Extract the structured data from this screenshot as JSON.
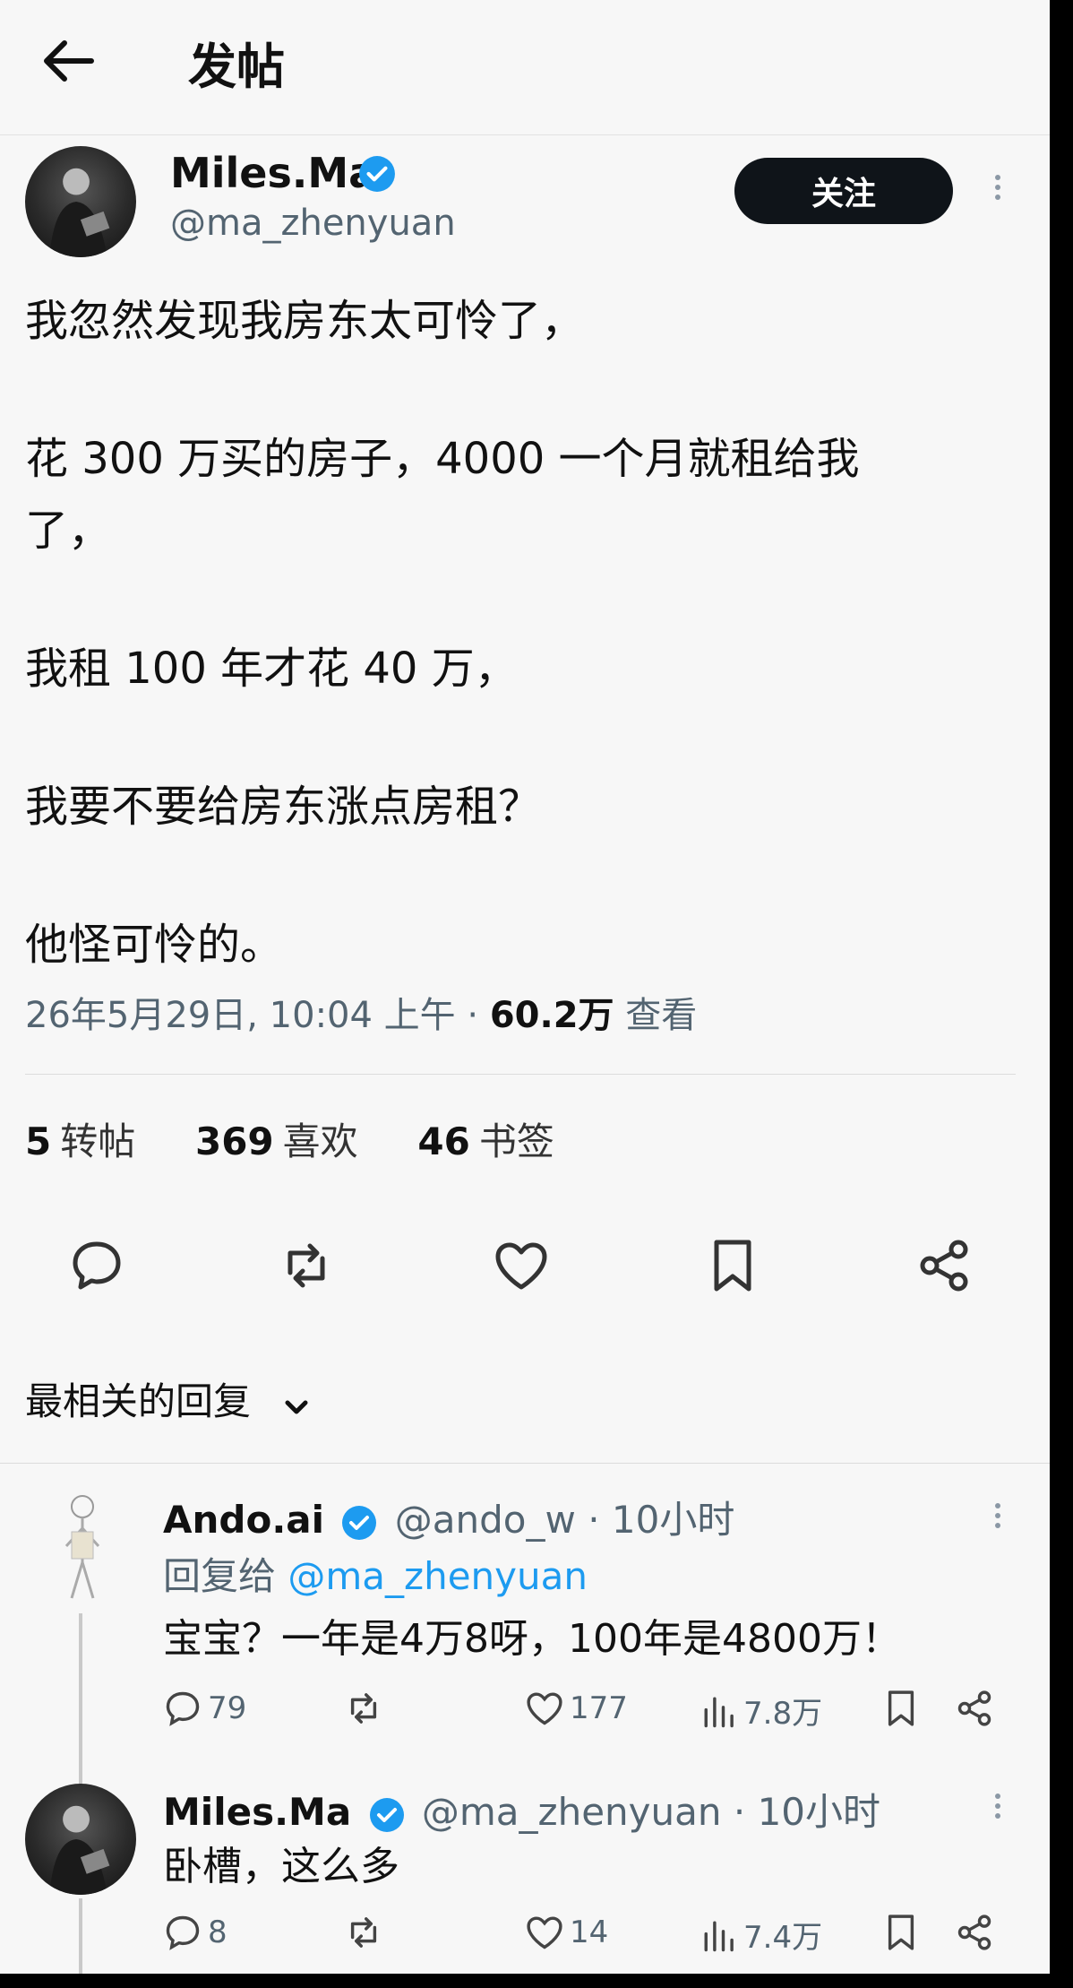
{
  "header": {
    "title": "发帖"
  },
  "post": {
    "author_name": "Miles.Ma",
    "author_handle": "@ma_zhenyuan",
    "follow_label": "关注",
    "lines": [
      "我忽然发现我房东太可怜了，",
      "花 300 万买的房子，4000 一个月就租给我",
      "了，",
      "我租 100 年才花 40 万，",
      "我要不要给房东涨点房租？",
      "他怪可怜的。"
    ],
    "datetime": "26年5月29日, 10:04 上午",
    "view_count": "60.2万",
    "view_label": "查看",
    "reposts_count": "5",
    "reposts_label": "转帖",
    "likes_count": "369",
    "likes_label": "喜欢",
    "bookmarks_count": "46",
    "bookmarks_label": "书签"
  },
  "replies_sort_label": "最相关的回复",
  "replies": [
    {
      "name": "Ando.ai",
      "handle": "@ando_w",
      "time": "10小时",
      "reply_to_label": "回复给",
      "reply_to_handle": "@ma_zhenyuan",
      "text": "宝宝？一年是4万8呀，100年是4800万！",
      "comments": "79",
      "likes": "177",
      "views": "7.8万"
    },
    {
      "name": "Miles.Ma",
      "handle": "@ma_zhenyuan",
      "time": "10小时",
      "text": "卧槽，这么多",
      "comments": "8",
      "likes": "14",
      "views": "7.4万"
    }
  ],
  "colors": {
    "accent": "#1d9bf0",
    "text": "#0f1419",
    "muted": "#536471",
    "background": "#f7f7f7"
  }
}
